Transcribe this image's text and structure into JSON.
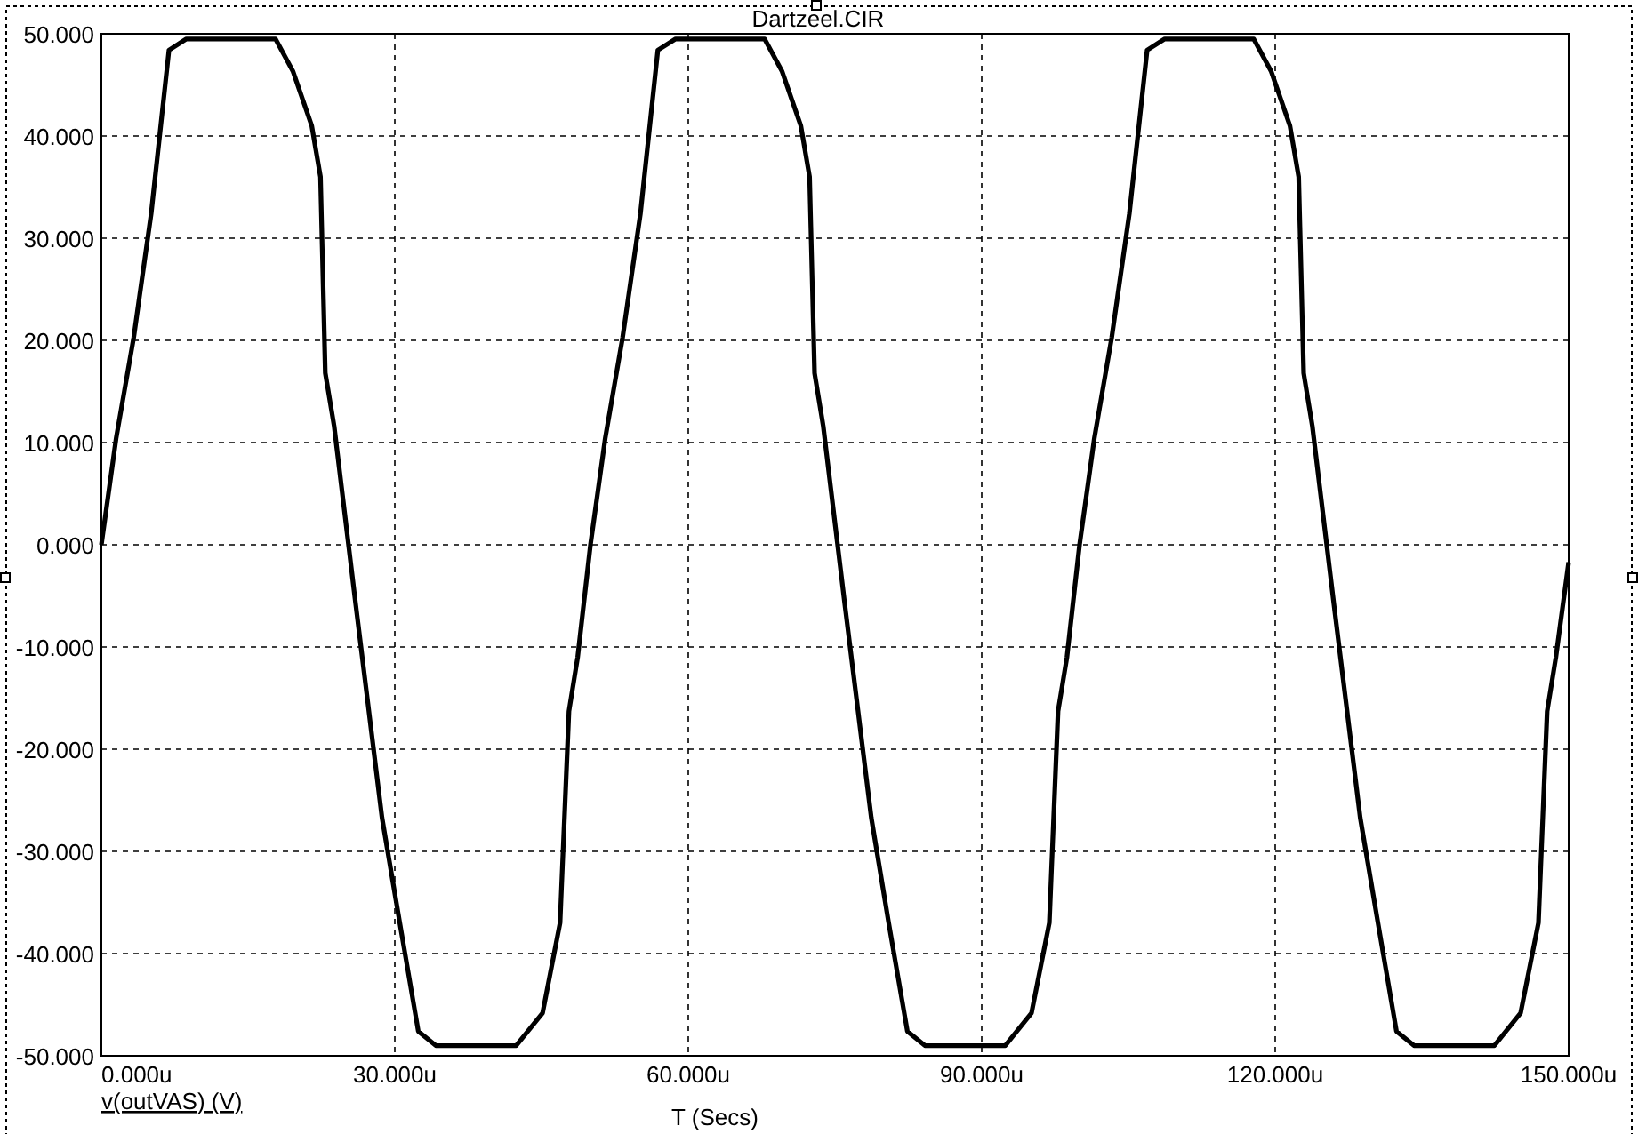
{
  "chart": {
    "chart_data": {
      "type": "line",
      "title": "Dartzeel.CIR",
      "xlabel": "T (Secs)",
      "grid": true,
      "x": [
        0,
        1.5,
        3.3,
        5.1,
        6.9,
        8.7,
        17.8,
        19.6,
        21.5,
        22.4,
        22.9,
        23.8,
        26,
        28.7,
        30.5,
        32.4,
        34.2,
        42.4,
        45.1,
        46.9,
        47.8,
        48.7,
        50,
        51.5,
        53.3,
        55.1,
        56.9,
        58.7,
        67.8,
        69.6,
        71.5,
        72.4,
        72.9,
        73.8,
        76,
        78.7,
        80.5,
        82.4,
        84.2,
        92.4,
        95.1,
        96.9,
        97.8,
        98.7,
        100,
        101.5,
        103.3,
        105.1,
        106.9,
        108.7,
        117.8,
        119.6,
        121.5,
        122.4,
        122.9,
        123.8,
        126,
        128.7,
        130.5,
        132.4,
        134.2,
        142.4,
        145.1,
        146.9,
        147.8,
        148.7,
        150
      ],
      "series": [
        {
          "name": "v(outVAS) (V)",
          "color": "#000000",
          "values": [
            0,
            10.4,
            20.3,
            32.4,
            48.4,
            49.5,
            49.5,
            46.3,
            41,
            36,
            16.8,
            11.6,
            -5.8,
            -26.7,
            -37,
            -47.6,
            -49,
            -49,
            -45.8,
            -37,
            -16.3,
            -11,
            0,
            10.4,
            20.3,
            32.4,
            48.4,
            49.5,
            49.5,
            46.3,
            41,
            36,
            16.8,
            11.6,
            -5.8,
            -26.7,
            -37,
            -47.6,
            -49,
            -49,
            -45.8,
            -37,
            -16.3,
            -11,
            0,
            10.4,
            20.3,
            32.4,
            48.4,
            49.5,
            49.5,
            46.3,
            41,
            36,
            16.8,
            11.6,
            -5.8,
            -26.7,
            -37,
            -47.6,
            -49,
            -49,
            -45.8,
            -37,
            -16.3,
            -11,
            -1.7
          ]
        }
      ],
      "xlim": [
        0,
        150
      ],
      "ylim": [
        -50,
        50
      ],
      "xticks": [
        {
          "value": 0,
          "label": "0.000u"
        },
        {
          "value": 30,
          "label": "30.000u"
        },
        {
          "value": 60,
          "label": "60.000u"
        },
        {
          "value": 90,
          "label": "90.000u"
        },
        {
          "value": 120,
          "label": "120.000u"
        },
        {
          "value": 150,
          "label": "150.000u"
        }
      ],
      "yticks": [
        {
          "value": 50,
          "label": "50.000"
        },
        {
          "value": 40,
          "label": "40.000"
        },
        {
          "value": 30,
          "label": "30.000"
        },
        {
          "value": 20,
          "label": "20.000"
        },
        {
          "value": 10,
          "label": "10.000"
        },
        {
          "value": 0,
          "label": "0.000"
        },
        {
          "value": -10,
          "label": "-10.000"
        },
        {
          "value": -20,
          "label": "-20.000"
        },
        {
          "value": -30,
          "label": "-30.000"
        },
        {
          "value": -40,
          "label": "-40.000"
        },
        {
          "value": -50,
          "label": "-50.000"
        }
      ]
    }
  }
}
